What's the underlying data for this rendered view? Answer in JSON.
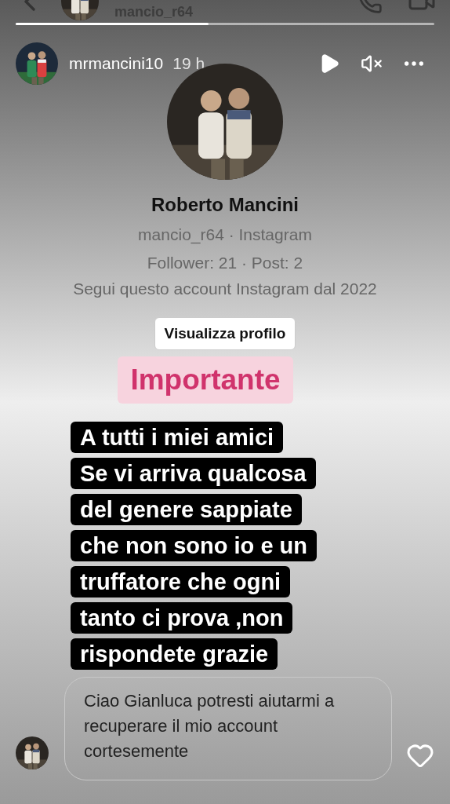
{
  "top_bar": {
    "username": "mancio_r64"
  },
  "progress": {
    "level": 0.46
  },
  "header": {
    "username": "mrmancini10",
    "time": "19 h",
    "paused": true,
    "muted": true
  },
  "profile_card": {
    "name": "Roberto Mancini",
    "handle": "mancio_r64 · Instagram",
    "stats": "Follower: 21 · Post: 2",
    "note": "Segui questo account Instagram dal 2022",
    "button": "Visualizza profilo"
  },
  "label": "Importante",
  "caption_lines": [
    "A tutti i miei amici",
    "Se vi arriva qualcosa",
    "del genere sappiate",
    "che non sono io e un",
    "truffatore che ogni",
    "tanto ci prova ,non",
    "rispondete grazie"
  ],
  "message": {
    "text": "Ciao Gianluca potresti aiutarmi a recuperare il mio account cortesemente",
    "liked": false
  }
}
